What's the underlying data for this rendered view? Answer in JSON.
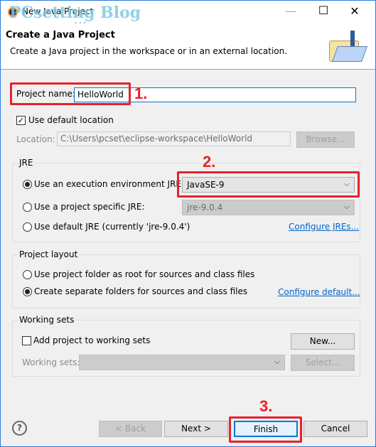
{
  "window": {
    "title": "New Java Project",
    "minimize": "—",
    "maximize": "☐",
    "close": "✕"
  },
  "watermark": {
    "line1": "PCsetting Blog",
    "line2": "www.pcsetting.com"
  },
  "header": {
    "title": "Create a Java Project",
    "description": "Create a Java project in the workspace or in an external location."
  },
  "project": {
    "label": "Project name:",
    "value": "HelloWorld"
  },
  "location": {
    "use_default_label": "Use default location",
    "use_default_checked": true,
    "label": "Location:",
    "value": "C:\\Users\\pcset\\eclipse-workspace\\HelloWorld",
    "browse": "Browse..."
  },
  "jre": {
    "legend": "JRE",
    "options": [
      {
        "label": "Use an execution environment JRE:",
        "selected": true
      },
      {
        "label": "Use a project specific JRE:",
        "selected": false
      },
      {
        "label": "Use default JRE (currently 'jre-9.0.4')",
        "selected": false
      }
    ],
    "env_value": "JavaSE-9",
    "specific_value": "jre-9.0.4",
    "configure": "Configure JREs..."
  },
  "layout": {
    "legend": "Project layout",
    "options": [
      {
        "label": "Use project folder as root for sources and class files",
        "selected": false
      },
      {
        "label": "Create separate folders for sources and class files",
        "selected": true
      }
    ],
    "configure": "Configure default..."
  },
  "working_sets": {
    "legend": "Working sets",
    "add_label": "Add project to working sets",
    "add_checked": false,
    "new": "New...",
    "label": "Working sets:",
    "select": "Select..."
  },
  "footer": {
    "help": "?",
    "back": "< Back",
    "next": "Next >",
    "finish": "Finish",
    "cancel": "Cancel"
  },
  "annotations": {
    "step1": "1.",
    "step2": "2.",
    "step3": "3."
  },
  "colors": {
    "annotation": "#e8212b",
    "link": "#0066cc",
    "border": "#2b79d8"
  }
}
